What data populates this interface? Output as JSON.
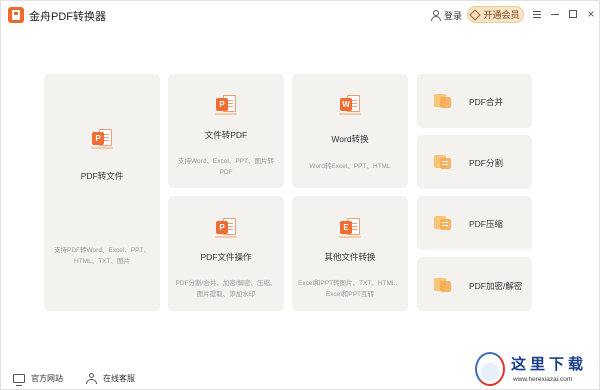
{
  "titlebar": {
    "app_title": "金舟PDF转换器",
    "login_label": "登录",
    "vip_label": "开通会员"
  },
  "cards": {
    "pdf_to_file": {
      "title": "PDF转文件",
      "desc": "支持PDF转Word、Excel、PPT、HTML、TXT、图片",
      "icon": "P"
    },
    "file_to_pdf": {
      "title": "文件转PDF",
      "desc": "支持Word、Excel、PPT、图片转PDF",
      "icon": "P"
    },
    "word_convert": {
      "title": "Word转换",
      "desc": "Word转Excel、PPT、HTML",
      "icon": "W"
    },
    "pdf_ops": {
      "title": "PDF文件操作",
      "desc": "PDF分割/合并、加密/解密、压缩、图片提取、添加水印",
      "icon": "P"
    },
    "other_convert": {
      "title": "其他文件转换",
      "desc": "Excel和PPT转图片、TXT、HTML、Excel和PPT互转",
      "icon": "E"
    }
  },
  "tools": {
    "merge": "PDF合并",
    "split": "PDF分割",
    "compress": "PDF压缩",
    "encrypt": "PDF加密/解密"
  },
  "bottombar": {
    "website_label": "官方网站",
    "service_label": "在线客服"
  },
  "watermark": {
    "text": "这里下载",
    "url": "www.herexiazai.com"
  },
  "colors": {
    "accent": "#ef6d33",
    "card_bg": "#f4f2ef",
    "vip_bg": "#f8e3c6"
  }
}
